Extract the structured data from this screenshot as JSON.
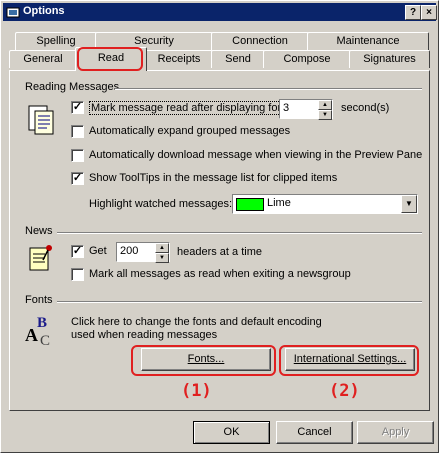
{
  "window": {
    "title": "Options",
    "help_btn": "?",
    "close_btn": "×"
  },
  "tabs": {
    "back": [
      "Spelling",
      "Security",
      "Connection",
      "Maintenance"
    ],
    "front": [
      "General",
      "Read",
      "Receipts",
      "Send",
      "Compose",
      "Signatures"
    ],
    "active": "Read"
  },
  "reading": {
    "section": "Reading Messages",
    "mark_read": "Mark message read after displaying for",
    "mark_seconds": "3",
    "seconds_unit": "second(s)",
    "expand_groups": "Automatically expand grouped messages",
    "auto_download": "Automatically download message when viewing in the Preview Pane",
    "tooltips": "Show ToolTips in the message list for clipped items",
    "highlight_label": "Highlight watched messages:",
    "highlight_value": "Lime",
    "highlight_color": "#00ff00"
  },
  "news": {
    "section": "News",
    "get_label": "Get",
    "get_value": "200",
    "headers_suffix": "headers at a time",
    "mark_all": "Mark all messages as read when exiting a newsgroup"
  },
  "fonts": {
    "section": "Fonts",
    "desc_line1": "Click here to change the fonts and default encoding",
    "desc_line2": "used when reading messages",
    "fonts_btn": "Fonts...",
    "intl_btn": "International Settings..."
  },
  "annotations": {
    "one": "(1)",
    "two": "(2)"
  },
  "footer": {
    "ok": "OK",
    "cancel": "Cancel",
    "apply": "Apply"
  },
  "colors": {
    "annotation": "#e02020",
    "titlebar": "#0a246a"
  }
}
